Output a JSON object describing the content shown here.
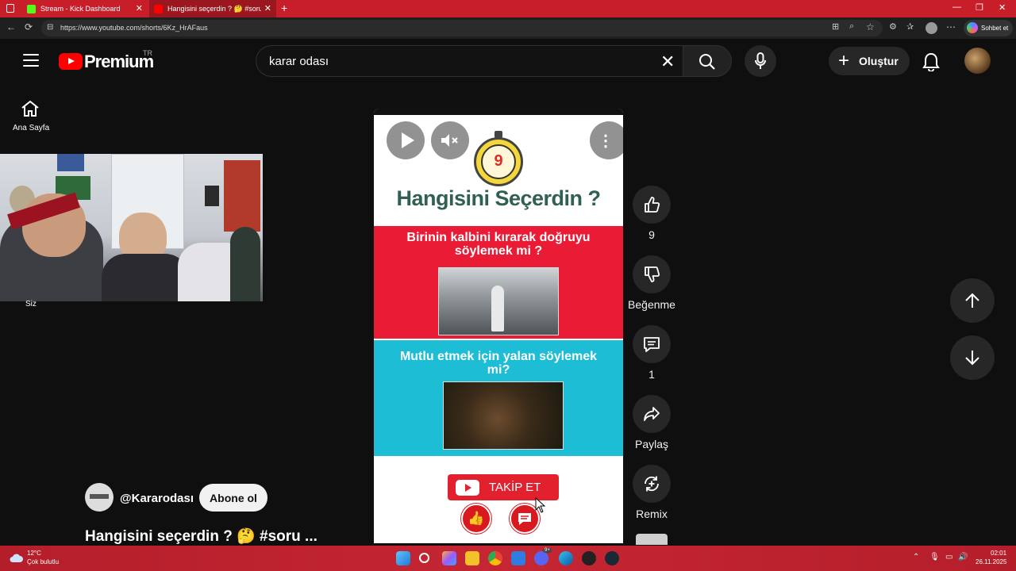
{
  "browser": {
    "tabs": [
      {
        "title": "Stream - Kick Dashboard",
        "icon": "kick-icon"
      },
      {
        "title": "Hangisini seçerdin ? 🤔 #soru #e",
        "icon": "youtube-icon"
      }
    ],
    "url": "https://www.youtube.com/shorts/6Kz_HrAFaus",
    "copilot_label": "Sohbet et"
  },
  "header": {
    "logo_text": "Premium",
    "region": "TR",
    "search_query": "karar odası",
    "create_label": "Oluştur"
  },
  "sidebar": {
    "home_label": "Ana Sayfa"
  },
  "webcam": {
    "label": "Siz"
  },
  "video": {
    "timer_value": "9",
    "question_title": "Hangisini Seçerdin ?",
    "option1_text": "Birinin kalbini kırarak doğruyu söylemek mi ?",
    "option2_text": "Mutlu etmek için yalan söylemek mi?",
    "follow_label": "TAKİP ET"
  },
  "actions": {
    "like_count": "9",
    "dislike_label": "Beğenme",
    "comment_count": "1",
    "share_label": "Paylaş",
    "remix_label": "Remix"
  },
  "channel": {
    "handle": "@Kararodası",
    "subscribe_label": "Abone ol",
    "short_title": "Hangisini seçerdin ? 🤔 #soru ..."
  },
  "taskbar": {
    "weather_temp": "12°C",
    "weather_desc": "Çok bulutlu",
    "time": "02:01",
    "date": "26.11.2025",
    "badge": "9+"
  },
  "colors": {
    "browser_accent": "#c81e2a",
    "youtube_red": "#ff0000",
    "option1_bg": "#ea1c35",
    "option2_bg": "#1dbdd6",
    "title_green": "#2f5f55"
  }
}
